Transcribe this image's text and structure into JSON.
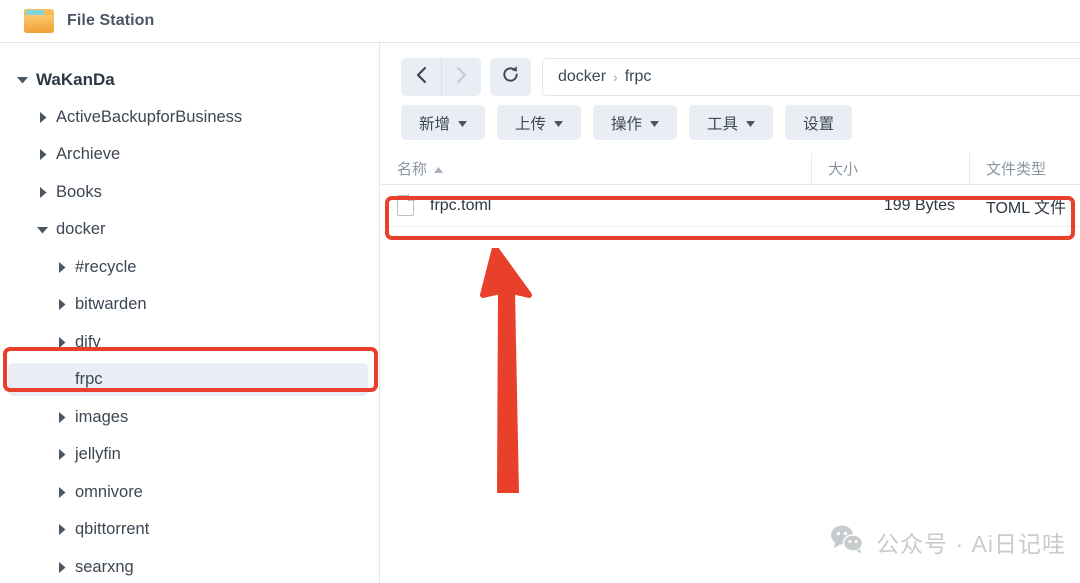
{
  "header": {
    "title": "File Station",
    "icon": "folder-icon"
  },
  "sidebar": {
    "items": [
      {
        "label": "WaKanDa",
        "level": 0,
        "expanded": true,
        "selected": false,
        "caret": "caret-down"
      },
      {
        "label": "ActiveBackupforBusiness",
        "level": 1,
        "expanded": false,
        "selected": false,
        "caret": "caret-right"
      },
      {
        "label": "Archieve",
        "level": 1,
        "expanded": false,
        "selected": false,
        "caret": "caret-right"
      },
      {
        "label": "Books",
        "level": 1,
        "expanded": false,
        "selected": false,
        "caret": "caret-right"
      },
      {
        "label": "docker",
        "level": 1,
        "expanded": true,
        "selected": false,
        "caret": "caret-down"
      },
      {
        "label": "#recycle",
        "level": 2,
        "expanded": false,
        "selected": false,
        "caret": "caret-right"
      },
      {
        "label": "bitwarden",
        "level": 2,
        "expanded": false,
        "selected": false,
        "caret": "caret-right"
      },
      {
        "label": "dify",
        "level": 2,
        "expanded": false,
        "selected": false,
        "caret": "caret-right"
      },
      {
        "label": "frpc",
        "level": 2,
        "expanded": false,
        "selected": true,
        "caret": "none"
      },
      {
        "label": "images",
        "level": 2,
        "expanded": false,
        "selected": false,
        "caret": "caret-right"
      },
      {
        "label": "jellyfin",
        "level": 2,
        "expanded": false,
        "selected": false,
        "caret": "caret-right"
      },
      {
        "label": "omnivore",
        "level": 2,
        "expanded": false,
        "selected": false,
        "caret": "caret-right"
      },
      {
        "label": "qbittorrent",
        "level": 2,
        "expanded": false,
        "selected": false,
        "caret": "caret-right"
      },
      {
        "label": "searxng",
        "level": 2,
        "expanded": false,
        "selected": false,
        "caret": "caret-right"
      }
    ]
  },
  "nav": {
    "back_icon": "chevron-left-icon",
    "forward_icon": "chevron-right-icon",
    "refresh_icon": "refresh-icon",
    "breadcrumb": [
      "docker",
      "frpc"
    ],
    "separator": "›"
  },
  "toolbar": {
    "buttons": [
      {
        "label": "新增",
        "dropdown": true
      },
      {
        "label": "上传",
        "dropdown": true
      },
      {
        "label": "操作",
        "dropdown": true
      },
      {
        "label": "工具",
        "dropdown": true
      },
      {
        "label": "设置",
        "dropdown": false
      }
    ]
  },
  "file_table": {
    "columns": [
      {
        "label": "名称",
        "sorted": "asc"
      },
      {
        "label": "大小",
        "sorted": ""
      },
      {
        "label": "文件类型",
        "sorted": ""
      }
    ],
    "rows": [
      {
        "name": "frpc.toml",
        "size": "199 Bytes",
        "type": "TOML 文件",
        "icon": "file-icon",
        "highlighted": true
      }
    ]
  },
  "annotations": {
    "color": "#e8402a",
    "arrow_icon": "up-arrow-icon",
    "boxes": [
      "sidebar-frpc",
      "file-row-frpc-toml"
    ]
  },
  "watermark": {
    "icon": "wechat-icon",
    "text": "公众号 · Ai日记哇"
  }
}
